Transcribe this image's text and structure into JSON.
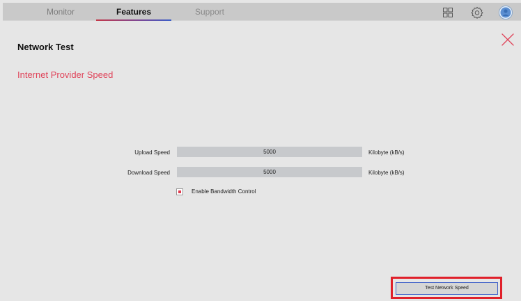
{
  "nav": {
    "tabs": [
      {
        "label": "Monitor",
        "active": false
      },
      {
        "label": "Features",
        "active": true
      },
      {
        "label": "Support",
        "active": false
      }
    ],
    "icons": [
      "grid-icon",
      "gear-icon",
      "avatar-icon"
    ]
  },
  "page": {
    "title": "Network Test",
    "section_title": "Internet Provider Speed",
    "close_icon": "close-icon"
  },
  "upload": {
    "label": "Upload Speed",
    "value": "5000",
    "unit": "Kilobyte (kB/s)"
  },
  "download": {
    "label": "Download Speed",
    "value": "5000",
    "unit": "Kilobyte (kB/s)"
  },
  "bandwidth": {
    "label": "Enable Bandwidth Control",
    "checked": true
  },
  "actions": {
    "test_label": "Test Network Speed"
  },
  "colors": {
    "accent": "#e0445a",
    "highlight": "#e0202a",
    "button_border": "#3d5fc8"
  }
}
